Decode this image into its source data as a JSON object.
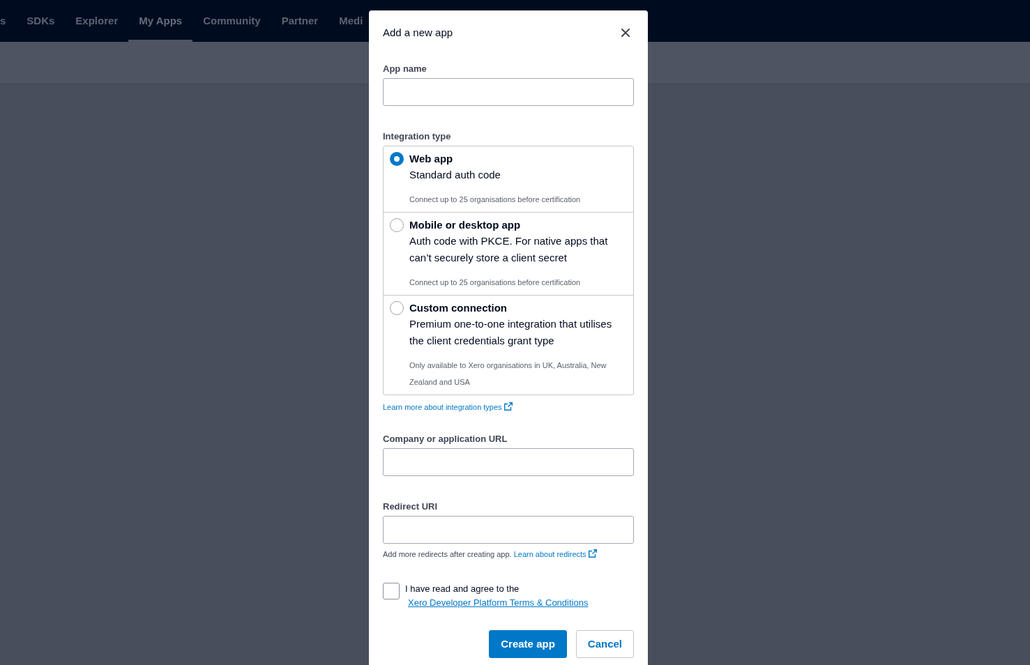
{
  "nav_items": [
    {
      "label": "s",
      "selected": false
    },
    {
      "label": "SDKs",
      "selected": false
    },
    {
      "label": "Explorer",
      "selected": false
    },
    {
      "label": "My Apps",
      "selected": true
    },
    {
      "label": "Community",
      "selected": false
    },
    {
      "label": "Partner",
      "selected": false
    },
    {
      "label": "Medi",
      "selected": false
    }
  ],
  "dialog": {
    "title": "Add a new app",
    "fields": [
      {
        "kind": "text",
        "label": "App name"
      },
      {
        "kind": "radio_group",
        "label": "Integration type",
        "options": [
          {
            "title": "Web app",
            "description": "Standard auth code",
            "note": "Connect up to 25 organisations before certification",
            "selected": true
          },
          {
            "title": "Mobile or desktop app",
            "description": "Auth code with PKCE. For native apps that can’t securely store a client secret",
            "note": "Connect up to 25 organisations before certification",
            "selected": false
          },
          {
            "title": "Custom connection",
            "description": "Premium one-to-one integration that utilises the client credentials grant type",
            "note": "Only available to Xero organisations in UK, Australia, New Zealand and USA",
            "selected": false
          }
        ],
        "link": "Learn more about integration types"
      },
      {
        "kind": "text",
        "label": "Company or application URL"
      },
      {
        "kind": "text",
        "label": "Redirect URI",
        "help": "Add more redirects after creating app.",
        "link": "Learn about redirects"
      }
    ],
    "terms": {
      "checked": false,
      "text": "I have read and agree to the",
      "link": "Xero Developer Platform Terms & Conditions"
    },
    "buttons": [
      {
        "label": "Create app",
        "kind": "primary"
      },
      {
        "label": "Cancel",
        "kind": "secondary"
      }
    ]
  }
}
